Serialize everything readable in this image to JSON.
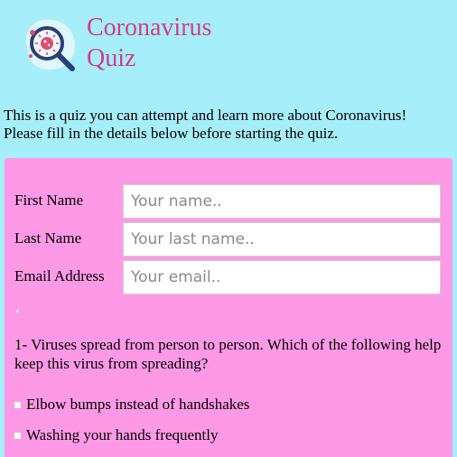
{
  "header": {
    "title_line1": "Coronavirus",
    "title_line2": "Quiz",
    "logo_icon": "virus-magnifier-icon"
  },
  "intro": {
    "line1": "This is a quiz you can attempt and learn more about Coronavirus!",
    "line2": "Please fill in the details below before starting the quiz."
  },
  "form": {
    "first_name": {
      "label": "First Name",
      "placeholder": "Your name..",
      "value": ""
    },
    "last_name": {
      "label": "Last Name",
      "placeholder": "Your last name..",
      "value": ""
    },
    "email": {
      "label": "Email Address",
      "placeholder": "Your email..",
      "value": ""
    }
  },
  "quiz": {
    "question": "1- Viruses spread from person to person. Which of the following help keep this virus from spreading?",
    "options": [
      {
        "label": "Elbow bumps instead of handshakes"
      },
      {
        "label": "Washing your hands frequently"
      }
    ]
  },
  "colors": {
    "background": "#a5eefa",
    "panel": "#fe99e6",
    "title": "#d63c8a"
  }
}
